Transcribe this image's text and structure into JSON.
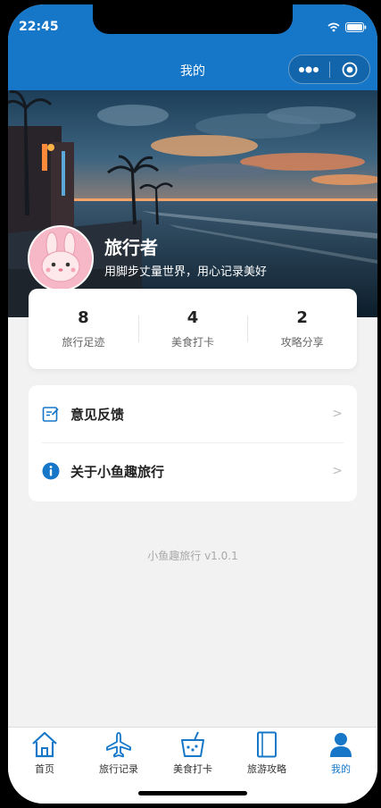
{
  "status": {
    "time": "22:45"
  },
  "navbar": {
    "title": "我的"
  },
  "profile": {
    "name": "旅行者",
    "bio": "用脚步丈量世界，用心记录美好"
  },
  "stats": [
    {
      "value": "8",
      "label": "旅行足迹"
    },
    {
      "value": "4",
      "label": "美食打卡"
    },
    {
      "value": "2",
      "label": "攻略分享"
    }
  ],
  "menu": [
    {
      "label": "意见反馈",
      "arrow": ">",
      "icon": "feedback-icon"
    },
    {
      "label": "关于小鱼趣旅行",
      "arrow": ">",
      "icon": "info-icon"
    }
  ],
  "version": "小鱼趣旅行 v1.0.1",
  "tabs": [
    {
      "label": "首页",
      "icon": "home-icon"
    },
    {
      "label": "旅行记录",
      "icon": "plane-icon"
    },
    {
      "label": "美食打卡",
      "icon": "drink-icon"
    },
    {
      "label": "旅游攻略",
      "icon": "book-icon"
    },
    {
      "label": "我的",
      "icon": "user-icon",
      "active": true
    }
  ],
  "colors": {
    "primary": "#1677c9",
    "background": "#f2f2f2"
  }
}
